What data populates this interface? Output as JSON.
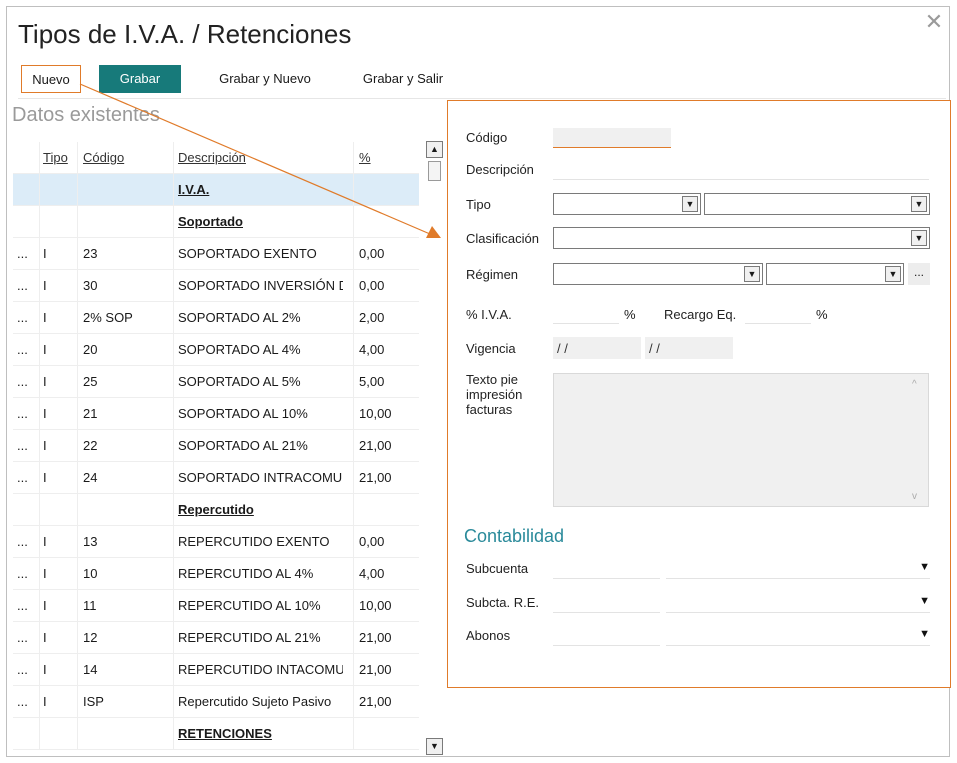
{
  "window": {
    "title": "Tipos de I.V.A. / Retenciones"
  },
  "toolbar": {
    "nuevo": "Nuevo",
    "grabar": "Grabar",
    "grabar_nuevo": "Grabar y Nuevo",
    "grabar_salir": "Grabar y Salir"
  },
  "list": {
    "section_label": "Datos existentes",
    "columns": {
      "tipo": "Tipo",
      "codigo": "Código",
      "descripcion": "Descripción",
      "pct": "%"
    },
    "rows": [
      {
        "group": "I.V.A.",
        "selected": true
      },
      {
        "group": "Soportado"
      },
      {
        "dots": "...",
        "tipo": "I",
        "codigo": "23",
        "descripcion": "SOPORTADO EXENTO",
        "pct": "0,00"
      },
      {
        "dots": "...",
        "tipo": "I",
        "codigo": "30",
        "descripcion": "SOPORTADO INVERSIÓN D",
        "pct": "0,00"
      },
      {
        "dots": "...",
        "tipo": "I",
        "codigo": "2% SOP",
        "descripcion": "SOPORTADO AL 2%",
        "pct": "2,00"
      },
      {
        "dots": "...",
        "tipo": "I",
        "codigo": "20",
        "descripcion": "SOPORTADO AL 4%",
        "pct": "4,00"
      },
      {
        "dots": "...",
        "tipo": "I",
        "codigo": "25",
        "descripcion": "SOPORTADO AL 5%",
        "pct": "5,00"
      },
      {
        "dots": "...",
        "tipo": "I",
        "codigo": "21",
        "descripcion": "SOPORTADO AL 10%",
        "pct": "10,00"
      },
      {
        "dots": "...",
        "tipo": "I",
        "codigo": "22",
        "descripcion": "SOPORTADO AL 21%",
        "pct": "21,00"
      },
      {
        "dots": "...",
        "tipo": "I",
        "codigo": "24",
        "descripcion": "SOPORTADO INTRACOMUI",
        "pct": "21,00"
      },
      {
        "group": "Repercutido"
      },
      {
        "dots": "...",
        "tipo": "I",
        "codigo": "13",
        "descripcion": "REPERCUTIDO EXENTO",
        "pct": "0,00"
      },
      {
        "dots": "...",
        "tipo": "I",
        "codigo": "10",
        "descripcion": "REPERCUTIDO AL 4%",
        "pct": "4,00"
      },
      {
        "dots": "...",
        "tipo": "I",
        "codigo": "11",
        "descripcion": "REPERCUTIDO AL 10%",
        "pct": "10,00"
      },
      {
        "dots": "...",
        "tipo": "I",
        "codigo": "12",
        "descripcion": "REPERCUTIDO AL 21%",
        "pct": "21,00"
      },
      {
        "dots": "...",
        "tipo": "I",
        "codigo": "14",
        "descripcion": "REPERCUTIDO INTACOMUI",
        "pct": "21,00"
      },
      {
        "dots": "...",
        "tipo": "I",
        "codigo": "ISP",
        "descripcion": "Repercutido Sujeto Pasivo",
        "pct": "21,00"
      },
      {
        "group": "RETENCIONES"
      }
    ]
  },
  "form": {
    "codigo": {
      "label": "Código",
      "value": ""
    },
    "descripcion": {
      "label": "Descripción",
      "value": ""
    },
    "tipo": {
      "label": "Tipo"
    },
    "clasificacion": {
      "label": "Clasificación"
    },
    "regimen": {
      "label": "Régimen",
      "more": "..."
    },
    "pct_iva": {
      "label": "% I.V.A.",
      "unit": "%",
      "value": ""
    },
    "recargo": {
      "label": "Recargo Eq.",
      "unit": "%",
      "value": ""
    },
    "vigencia": {
      "label": "Vigencia",
      "from": "/ /",
      "to": "/ /"
    },
    "texto_pie": {
      "label_lines": [
        "Texto pie",
        "impresión",
        "facturas"
      ],
      "value": ""
    },
    "contabilidad": {
      "title": "Contabilidad",
      "subcuenta": {
        "label": "Subcuenta"
      },
      "subcta_re": {
        "label": "Subcta. R.E."
      },
      "abonos": {
        "label": "Abonos"
      }
    }
  },
  "colors": {
    "accent_orange": "#e07b2a",
    "primary_teal": "#177a7a",
    "section_teal": "#2a8a9a",
    "selected_row": "#dcecf8"
  }
}
